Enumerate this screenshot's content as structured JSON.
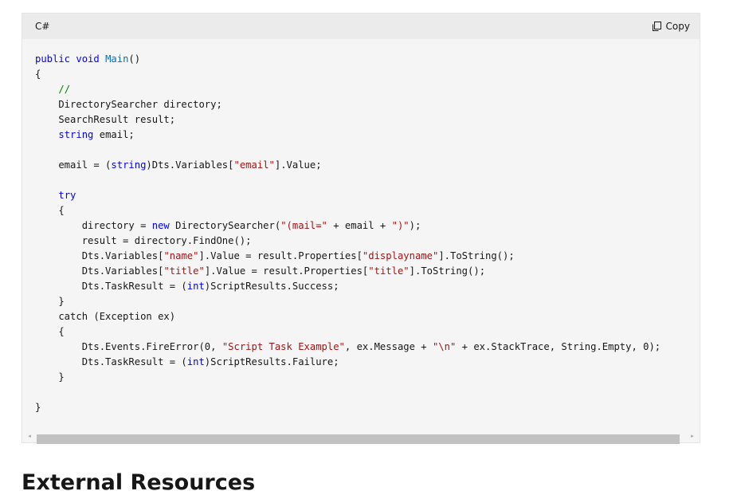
{
  "code_block": {
    "language": "C#",
    "copy_label": "Copy",
    "copy_icon": "copy-icon",
    "lines": [
      [
        {
          "t": "public void ",
          "c": "kw"
        },
        {
          "t": "Main",
          "c": "fn"
        },
        {
          "t": "()",
          "c": ""
        }
      ],
      [
        {
          "t": "{",
          "c": ""
        }
      ],
      [
        {
          "t": "    ",
          "c": ""
        },
        {
          "t": "//",
          "c": "cm"
        }
      ],
      [
        {
          "t": "    DirectorySearcher directory;",
          "c": ""
        }
      ],
      [
        {
          "t": "    SearchResult result;",
          "c": ""
        }
      ],
      [
        {
          "t": "    ",
          "c": ""
        },
        {
          "t": "string",
          "c": "kw"
        },
        {
          "t": " email;",
          "c": ""
        }
      ],
      [],
      [
        {
          "t": "    email = (",
          "c": ""
        },
        {
          "t": "string",
          "c": "kw"
        },
        {
          "t": ")Dts.Variables[",
          "c": ""
        },
        {
          "t": "\"email\"",
          "c": "str"
        },
        {
          "t": "].Value;",
          "c": ""
        }
      ],
      [],
      [
        {
          "t": "    ",
          "c": ""
        },
        {
          "t": "try",
          "c": "kw"
        }
      ],
      [
        {
          "t": "    {",
          "c": ""
        }
      ],
      [
        {
          "t": "        directory = ",
          "c": ""
        },
        {
          "t": "new",
          "c": "kw"
        },
        {
          "t": " DirectorySearcher(",
          "c": ""
        },
        {
          "t": "\"(mail=\"",
          "c": "str"
        },
        {
          "t": " + email + ",
          "c": ""
        },
        {
          "t": "\")\"",
          "c": "str"
        },
        {
          "t": ");",
          "c": ""
        }
      ],
      [
        {
          "t": "        result = directory.FindOne();",
          "c": ""
        }
      ],
      [
        {
          "t": "        Dts.Variables[",
          "c": ""
        },
        {
          "t": "\"name\"",
          "c": "str"
        },
        {
          "t": "].Value = result.Properties[",
          "c": ""
        },
        {
          "t": "\"displayname\"",
          "c": "str"
        },
        {
          "t": "].ToString();",
          "c": ""
        }
      ],
      [
        {
          "t": "        Dts.Variables[",
          "c": ""
        },
        {
          "t": "\"title\"",
          "c": "str"
        },
        {
          "t": "].Value = result.Properties[",
          "c": ""
        },
        {
          "t": "\"title\"",
          "c": "str"
        },
        {
          "t": "].ToString();",
          "c": ""
        }
      ],
      [
        {
          "t": "        Dts.TaskResult = (",
          "c": ""
        },
        {
          "t": "int",
          "c": "kw"
        },
        {
          "t": ")ScriptResults.Success;",
          "c": ""
        }
      ],
      [
        {
          "t": "    }",
          "c": ""
        }
      ],
      [
        {
          "t": "    catch (Exception ex)",
          "c": ""
        }
      ],
      [
        {
          "t": "    {",
          "c": ""
        }
      ],
      [
        {
          "t": "        Dts.Events.FireError(0, ",
          "c": ""
        },
        {
          "t": "\"Script Task Example\"",
          "c": "str"
        },
        {
          "t": ", ex.Message + ",
          "c": ""
        },
        {
          "t": "\"\\n\"",
          "c": "str"
        },
        {
          "t": " + ex.StackTrace, String.Empty, 0);",
          "c": ""
        }
      ],
      [
        {
          "t": "        Dts.TaskResult = (",
          "c": ""
        },
        {
          "t": "int",
          "c": "kw"
        },
        {
          "t": ")ScriptResults.Failure;",
          "c": ""
        }
      ],
      [
        {
          "t": "    }",
          "c": ""
        }
      ],
      [],
      [
        {
          "t": "}",
          "c": ""
        }
      ]
    ]
  },
  "scrollbar": {
    "left_arrow": "◂",
    "right_arrow": "▸"
  },
  "next_section": {
    "heading": "External Resources"
  }
}
